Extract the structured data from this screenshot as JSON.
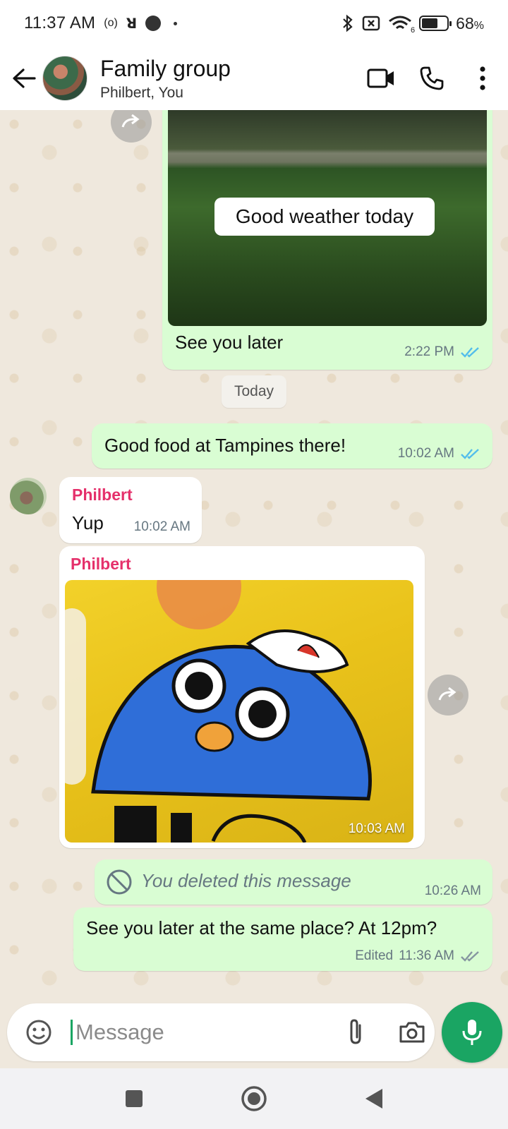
{
  "status_bar": {
    "time": "11:37 AM",
    "left_icons": [
      "radio-signal-icon",
      "network-icon",
      "record-dot-icon",
      "small-dot-icon"
    ],
    "right_icons": [
      "bluetooth-icon",
      "no-sim-icon",
      "wifi-6-icon",
      "battery-icon"
    ],
    "battery_level": 68,
    "battery_label": "68",
    "battery_unit": "%",
    "wifi_label": "6",
    "radio_label": "(o)",
    "network_label": "ꓤ"
  },
  "header": {
    "title": "Family group",
    "subtitle": "Philbert, You",
    "icons": [
      "back-arrow-icon",
      "video-call-icon",
      "phone-icon",
      "more-vertical-icon"
    ]
  },
  "messages": {
    "m1": {
      "image_caption": "Good weather today",
      "text": "See you later",
      "time": "2:22 PM",
      "status": "read"
    },
    "date_separator": "Today",
    "m2": {
      "text": "Good food at Tampines there!",
      "time": "10:02 AM",
      "status": "read"
    },
    "m3": {
      "sender": "Philbert",
      "text": "Yup",
      "time": "10:02 AM"
    },
    "m4": {
      "sender": "Philbert",
      "time": "10:03 AM"
    },
    "m5": {
      "text": "You deleted this message",
      "time": "10:26 AM"
    },
    "m6": {
      "text": "See you later at the same place? At 12pm?",
      "edited_label": "Edited",
      "time": "11:36 AM",
      "status": "delivered"
    }
  },
  "composer": {
    "placeholder": "Message",
    "icons": [
      "emoji-icon",
      "attach-icon",
      "camera-icon",
      "mic-icon"
    ]
  },
  "colors": {
    "outgoing_bubble": "#d9fdd3",
    "incoming_bubble": "#ffffff",
    "accent_green": "#1aa563",
    "sender_name": "#e5306b",
    "read_ticks": "#53bdeb"
  }
}
